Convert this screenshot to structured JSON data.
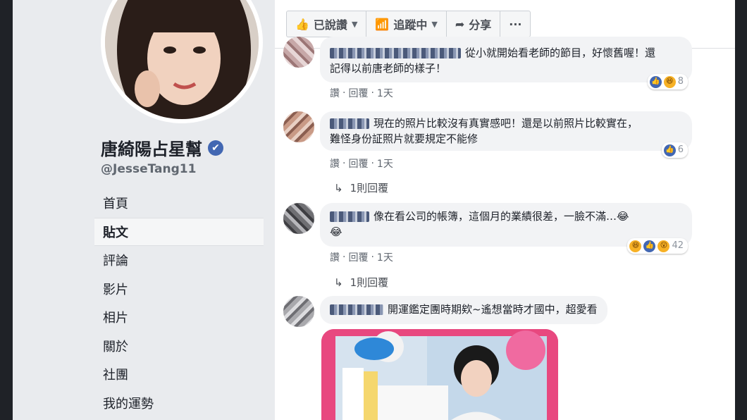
{
  "profile": {
    "name": "唐綺陽占星幫",
    "handle": "@JesseTang11"
  },
  "nav": [
    {
      "label": "首頁"
    },
    {
      "label": "貼文",
      "active": true
    },
    {
      "label": "評論"
    },
    {
      "label": "影片"
    },
    {
      "label": "相片"
    },
    {
      "label": "關於"
    },
    {
      "label": "社團"
    },
    {
      "label": "我的運勢"
    }
  ],
  "actions": {
    "liked_label": "已說讚",
    "following_label": "追蹤中",
    "share_label": "分享",
    "more_label": "···"
  },
  "comments": [
    {
      "text_line1": "從小就開始看老師的節目，好懷舊喔！還",
      "text_line2": "記得以前唐老師的樣子！",
      "reply": "讚",
      "respond": "回覆",
      "time": "1天",
      "reaction_count": "8"
    },
    {
      "text_line1": "現在的照片比較沒有真實感吧！還是以前照片比較實在，",
      "text_line2": "難怪身份証照片就要規定不能修",
      "reply": "讚",
      "respond": "回覆",
      "time": "1天",
      "reaction_count": "6",
      "replies_label": "1則回覆"
    },
    {
      "text_line1": "像在看公司的帳簿，這個月的業績很差，一臉不滿…😂",
      "text_line2": "😂",
      "reply": "讚",
      "respond": "回覆",
      "time": "1天",
      "reaction_count": "42",
      "replies_label": "1則回覆"
    },
    {
      "text_line1": "開運鑑定團時期欸~遙想當時才國中，超愛看"
    }
  ],
  "colors": {
    "brand": "#4267b2",
    "bubble": "#f2f3f5",
    "page_bg": "#e9ebee"
  }
}
